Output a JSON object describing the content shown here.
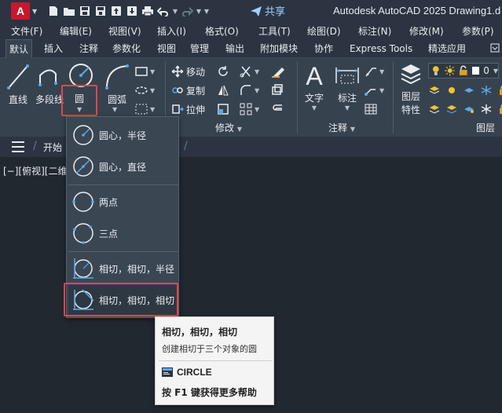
{
  "titlebar": {
    "logo_letter": "A",
    "share_label": "共享",
    "title": "Autodesk AutoCAD 2025    Drawing1.d",
    "qat_icons": [
      "new-file-icon",
      "open-folder-icon",
      "save-icon",
      "save-as-icon",
      "upload-icon",
      "download-icon",
      "print-icon",
      "undo-icon",
      "redo-icon",
      "qat-dropdown-icon",
      "share-icon"
    ]
  },
  "menubar": {
    "items": [
      "文件(F)",
      "编辑(E)",
      "视图(V)",
      "插入(I)",
      "格式(O)",
      "工具(T)",
      "绘图(D)",
      "标注(N)",
      "修改(M)",
      "参数(P)"
    ]
  },
  "ribbon_tabs": {
    "items": [
      "默认",
      "插入",
      "注释",
      "参数化",
      "视图",
      "管理",
      "输出",
      "附加模块",
      "协作",
      "Express Tools",
      "精选应用"
    ],
    "active": "默认"
  },
  "ribbon": {
    "draw": {
      "line": "直线",
      "polyline": "多段线",
      "circle": "圆",
      "arc": "圆弧"
    },
    "modify": {
      "move": "移动",
      "copy": "复制",
      "stretch": "拉伸",
      "panel_title": "修改"
    },
    "annotation": {
      "text": "文字",
      "dimension": "标注",
      "panel_title": "注释"
    },
    "layers": {
      "properties_line1": "图层",
      "properties_line2": "特性",
      "panel_title": "图层",
      "current_layer": "0"
    }
  },
  "file_tabs": {
    "start": "开始"
  },
  "viewport": {
    "label": "[−][俯视][二维"
  },
  "circle_dropdown": {
    "items": [
      {
        "label": "圆心，半径"
      },
      {
        "label": "圆心，直径"
      },
      {
        "label": "两点"
      },
      {
        "label": "三点"
      },
      {
        "label": "相切，相切，半径"
      },
      {
        "label": "相切，相切，相切"
      }
    ]
  },
  "tooltip": {
    "title": "相切，相切，相切",
    "description": "创建相切于三个对象的圆",
    "command": "CIRCLE",
    "help": "按 F1 键获得更多帮助"
  },
  "colors": {
    "highlight": "#e0454e",
    "ribbon_bg": "#37424f",
    "canvas_bg": "#212830",
    "accent_blue": "#5aa9e6"
  }
}
